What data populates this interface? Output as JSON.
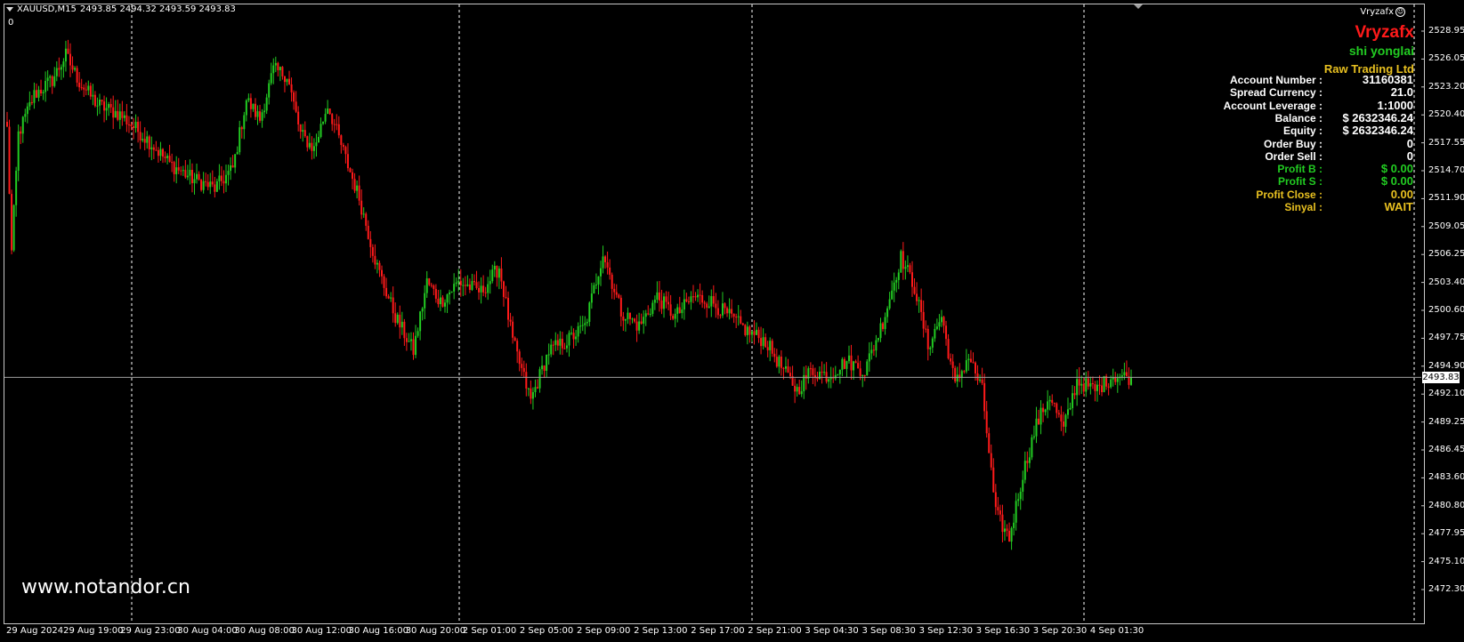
{
  "chart_header": {
    "symbol": "XAUUSD,M15",
    "ohlc": "2493.85 2494.32 2493.59 2493.83",
    "subwindow_label": "0"
  },
  "indicator_name": "Vryzafx",
  "panel": {
    "brand": "Vryzafx",
    "owner": "shi yonglai",
    "broker": "Raw Trading Ltd",
    "rows": [
      {
        "label": "Account Number :",
        "value": "31160381",
        "color": "#ffffff"
      },
      {
        "label": "Spread Currency :",
        "value": "21.0",
        "color": "#ffffff"
      },
      {
        "label": "Account Leverage :",
        "value": "1:1000",
        "color": "#ffffff"
      },
      {
        "label": "Balance  :",
        "value": "$ 2632346.24",
        "color": "#ffffff"
      },
      {
        "label": "Equity  :",
        "value": "$ 2632346.24",
        "color": "#ffffff"
      },
      {
        "label": "Order Buy :",
        "value": "0",
        "color": "#ffffff"
      },
      {
        "label": "Order Sell :",
        "value": "0",
        "color": "#ffffff"
      },
      {
        "label": "Profit B :",
        "value": "$ 0.00",
        "color": "#22cc22"
      },
      {
        "label": "Profit S :",
        "value": "$ 0.00",
        "color": "#22cc22"
      },
      {
        "label": "Profit Close :",
        "value": "0.00",
        "color": "#e8c020"
      },
      {
        "label": "Sinyal :",
        "value": "WAIT",
        "color": "#e8c020"
      }
    ],
    "colors": {
      "brand": "#ff1a1a",
      "owner": "#22cc22",
      "broker": "#e8c020"
    }
  },
  "watermark": "www.notandor.cn",
  "price_axis": {
    "labels": [
      "2528.95",
      "2526.05",
      "2523.20",
      "2520.40",
      "2517.55",
      "2514.70",
      "2511.90",
      "2509.05",
      "2506.25",
      "2503.40",
      "2500.60",
      "2497.75",
      "2494.90",
      "2492.10",
      "2489.25",
      "2486.45",
      "2483.60",
      "2480.80",
      "2477.95",
      "2475.10",
      "2472.30"
    ],
    "current_price": "2493.83"
  },
  "time_axis": {
    "labels": [
      "29 Aug 2024",
      "29 Aug 19:00",
      "29 Aug 23:00",
      "30 Aug 04:00",
      "30 Aug 08:00",
      "30 Aug 12:00",
      "30 Aug 16:00",
      "30 Aug 20:00",
      "2 Sep 01:00",
      "2 Sep 05:00",
      "2 Sep 09:00",
      "2 Sep 13:00",
      "2 Sep 17:00",
      "2 Sep 21:00",
      "3 Sep 04:30",
      "3 Sep 08:30",
      "3 Sep 12:30",
      "3 Sep 16:30",
      "3 Sep 20:30",
      "4 Sep 01:30"
    ]
  },
  "colors": {
    "bull": "#22cc22",
    "bear": "#ff1a1a",
    "grid": "#ffffff",
    "bid_line": "#a0a0a0"
  },
  "chart_data": {
    "type": "candlestick",
    "symbol": "XAUUSD",
    "timeframe": "M15",
    "ylim": [
      2472.3,
      2528.95
    ],
    "last_price": 2493.83,
    "anchors": [
      {
        "i": 0,
        "p": 2519.0
      },
      {
        "i": 2,
        "p": 2506.5
      },
      {
        "i": 5,
        "p": 2518.5
      },
      {
        "i": 12,
        "p": 2522.5
      },
      {
        "i": 20,
        "p": 2524.0
      },
      {
        "i": 26,
        "p": 2526.5
      },
      {
        "i": 32,
        "p": 2523.8
      },
      {
        "i": 40,
        "p": 2521.5
      },
      {
        "i": 50,
        "p": 2520.5
      },
      {
        "i": 62,
        "p": 2518.0
      },
      {
        "i": 72,
        "p": 2515.5
      },
      {
        "i": 82,
        "p": 2514.0
      },
      {
        "i": 92,
        "p": 2513.0
      },
      {
        "i": 100,
        "p": 2515.0
      },
      {
        "i": 106,
        "p": 2522.0
      },
      {
        "i": 112,
        "p": 2520.0
      },
      {
        "i": 118,
        "p": 2525.0
      },
      {
        "i": 124,
        "p": 2524.5
      },
      {
        "i": 130,
        "p": 2518.5
      },
      {
        "i": 136,
        "p": 2517.0
      },
      {
        "i": 142,
        "p": 2521.5
      },
      {
        "i": 150,
        "p": 2516.0
      },
      {
        "i": 156,
        "p": 2512.0
      },
      {
        "i": 164,
        "p": 2505.0
      },
      {
        "i": 172,
        "p": 2500.0
      },
      {
        "i": 180,
        "p": 2496.5
      },
      {
        "i": 186,
        "p": 2503.5
      },
      {
        "i": 192,
        "p": 2501.5
      },
      {
        "i": 200,
        "p": 2503.5
      },
      {
        "i": 210,
        "p": 2502.5
      },
      {
        "i": 218,
        "p": 2505.0
      },
      {
        "i": 224,
        "p": 2497.5
      },
      {
        "i": 232,
        "p": 2491.5
      },
      {
        "i": 240,
        "p": 2496.5
      },
      {
        "i": 248,
        "p": 2497.5
      },
      {
        "i": 256,
        "p": 2499.0
      },
      {
        "i": 264,
        "p": 2506.5
      },
      {
        "i": 272,
        "p": 2500.5
      },
      {
        "i": 280,
        "p": 2499.0
      },
      {
        "i": 288,
        "p": 2502.0
      },
      {
        "i": 296,
        "p": 2500.0
      },
      {
        "i": 304,
        "p": 2502.0
      },
      {
        "i": 312,
        "p": 2501.5
      },
      {
        "i": 320,
        "p": 2500.0
      },
      {
        "i": 328,
        "p": 2498.5
      },
      {
        "i": 336,
        "p": 2497.5
      },
      {
        "i": 344,
        "p": 2494.5
      },
      {
        "i": 350,
        "p": 2492.5
      },
      {
        "i": 356,
        "p": 2494.5
      },
      {
        "i": 364,
        "p": 2494.0
      },
      {
        "i": 372,
        "p": 2495.5
      },
      {
        "i": 380,
        "p": 2494.5
      },
      {
        "i": 388,
        "p": 2499.5
      },
      {
        "i": 396,
        "p": 2506.0
      },
      {
        "i": 402,
        "p": 2503.0
      },
      {
        "i": 408,
        "p": 2497.0
      },
      {
        "i": 414,
        "p": 2500.0
      },
      {
        "i": 420,
        "p": 2493.0
      },
      {
        "i": 426,
        "p": 2496.0
      },
      {
        "i": 432,
        "p": 2492.5
      },
      {
        "i": 438,
        "p": 2480.0
      },
      {
        "i": 444,
        "p": 2477.5
      },
      {
        "i": 450,
        "p": 2484.0
      },
      {
        "i": 456,
        "p": 2489.0
      },
      {
        "i": 462,
        "p": 2492.0
      },
      {
        "i": 468,
        "p": 2488.5
      },
      {
        "i": 474,
        "p": 2493.5
      },
      {
        "i": 482,
        "p": 2492.5
      },
      {
        "i": 490,
        "p": 2494.0
      },
      {
        "i": 498,
        "p": 2493.83
      }
    ]
  }
}
